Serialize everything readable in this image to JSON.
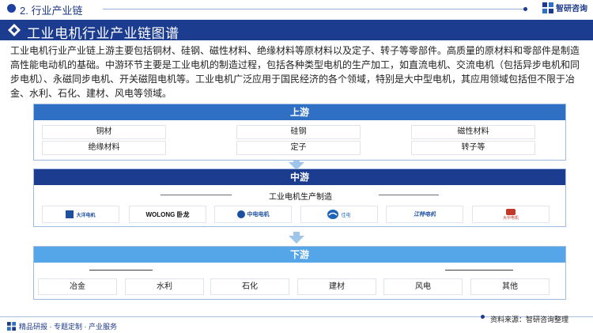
{
  "header": {
    "section_label": "2. 行业产业链",
    "brand_name": "智研咨询"
  },
  "banner": {
    "title": "工业电机行业产业链图谱"
  },
  "intro": {
    "text": "工业电机行业产业链上游主要包括铜材、硅钢、磁性材料、绝缘材料等原材料以及定子、转子等零部件。高质量的原材料和零部件是制造高性能电动机的基础。中游环节主要是工业电机的制造过程，包括各种类型电机的生产加工，如直流电机、交流电机（包括异步电机和同步电机）、永磁同步电机、开关磁阻电机等。工业电机广泛应用于国民经济的各个领域，特别是大中型电机，其应用领域包括但不限于冶金、水利、石化、建材、风电等领域。"
  },
  "upstream": {
    "title": "上游",
    "items": [
      "铜材",
      "硅钢",
      "磁性材料",
      "绝缘材料",
      "定子",
      "转子等"
    ]
  },
  "midstream": {
    "title": "中游",
    "subtitle": "工业电机生产制造",
    "logos": [
      {
        "text": "大洋电机",
        "color": "#1c4fa0"
      },
      {
        "text": "WOLONG 卧龙",
        "color": "#111111"
      },
      {
        "text": "中电电机",
        "color": "#1c4fa0"
      },
      {
        "text": "佳电",
        "color": "#1e63b8"
      },
      {
        "text": "江特电机",
        "color": "#1c4fa0"
      },
      {
        "text": "大中电机",
        "color": "#c0392b"
      }
    ]
  },
  "downstream": {
    "title": "下游",
    "items": [
      "冶金",
      "水利",
      "石化",
      "建材",
      "风电",
      "其他"
    ]
  },
  "footer": {
    "tagline": "精品研报 · 专题定制 · 产业服务",
    "source": "资料来源：智研咨询整理"
  },
  "colors": {
    "navy": "#1c3d8f",
    "upstream_blue": "#2f6fc4",
    "downstream_blue": "#54a6e8",
    "arrow": "#9ec6ea"
  }
}
